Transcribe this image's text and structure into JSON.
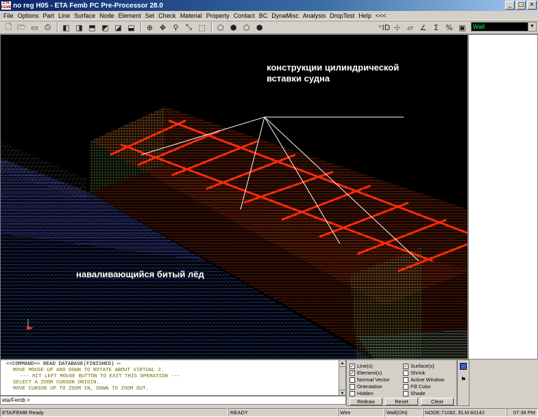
{
  "window": {
    "title": "no reg H05 - ETA Femb PC Pre-Processor 28.0",
    "logo_text": "eta femb",
    "controls": [
      "_",
      "□",
      "×"
    ]
  },
  "menu": [
    "File",
    "Options",
    "Part",
    "Line",
    "Surface",
    "Node",
    "Element",
    "Set",
    "Check",
    "Material",
    "Property",
    "Contact",
    "BC",
    "DynaMisc",
    "Analysis",
    "DropTest",
    "Help",
    "<<<"
  ],
  "toolbar": {
    "wall_select": "Wall"
  },
  "viewport": {
    "annotation_structures": [
      "конструкции цилиндрической",
      "вставки судна"
    ],
    "annotation_ice": "наваливающийся битый лёд"
  },
  "command": {
    "lines": [
      "<<COMMAND>> READ DATABASE(FINISHED) ⟵",
      "MOVE MOUSE UP AND DOWN TO ROTATE ABOUT VIRTUAL Z.",
      "--- HIT LEFT MOUSE BUTTON TO EXIT THIS OPERATION ---",
      "SELECT A ZOOM CURSOR ORIGIN.",
      "MOVE CURSOR UP TO ZOOM IN, DOWN TO ZOOM OUT."
    ],
    "prompt": "eta/Femb >"
  },
  "display_panel": {
    "left": [
      {
        "label": "Line(s)",
        "checked": true
      },
      {
        "label": "Element(s)",
        "checked": true
      },
      {
        "label": "Normal Vector",
        "checked": false
      },
      {
        "label": "Orientation",
        "checked": false
      },
      {
        "label": "Hidden",
        "checked": false
      }
    ],
    "right": [
      {
        "label": "Surface(s)",
        "checked": true
      },
      {
        "label": "Shrink",
        "checked": false
      },
      {
        "label": "Active Window",
        "checked": false
      },
      {
        "label": "Fill Color",
        "checked": false
      },
      {
        "label": "Shade",
        "checked": false
      }
    ],
    "buttons": {
      "redraw": "Redraw",
      "reset": "Reset",
      "clear": "Clear"
    }
  },
  "status": {
    "app": "ETA/FEMB Ready",
    "state": "READY",
    "mode": "Wire",
    "wall": "Wall(ON)",
    "counts": "NODE:71082, ELM:60142",
    "time": "07:39 PM"
  },
  "colors": {
    "ice": "#3a5fd9",
    "structure_red": "#ff3a10",
    "structure_green": "#7ed957",
    "background": "#000000"
  }
}
